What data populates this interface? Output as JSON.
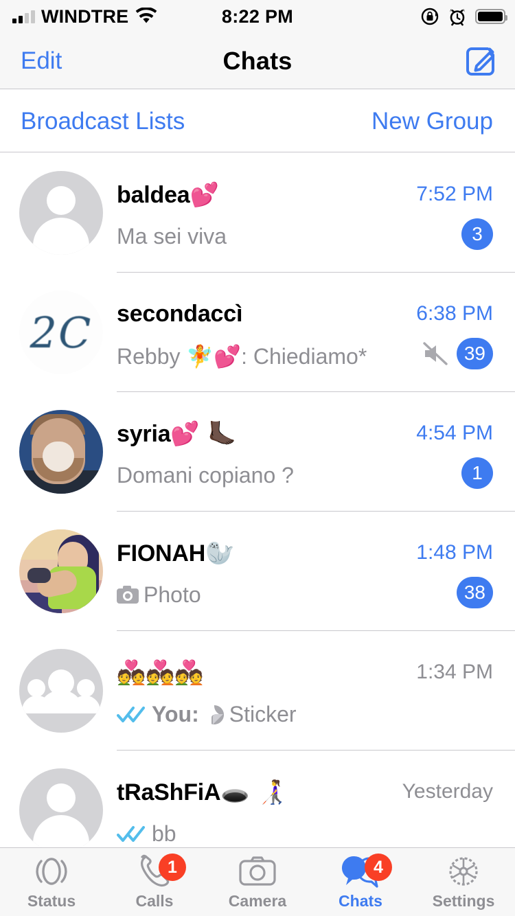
{
  "status_bar": {
    "carrier": "WINDTRE",
    "time": "8:22 PM",
    "wifi_icon": "wifi-icon",
    "rotation_lock_icon": "rotation-lock-icon",
    "alarm_icon": "alarm-icon",
    "battery_icon": "battery-full-icon"
  },
  "nav_bar": {
    "edit_label": "Edit",
    "title": "Chats",
    "compose_icon": "compose-icon"
  },
  "sub_header": {
    "broadcast_label": "Broadcast Lists",
    "new_group_label": "New Group"
  },
  "colors": {
    "accent_blue": "#3e7bf0",
    "badge_red": "#f93f25",
    "secondary_text": "#8e8e93",
    "separator": "#c8c7cc",
    "bar_background": "#f7f7f7"
  },
  "chats": [
    {
      "name": "baldea",
      "name_emoji": "💕",
      "preview": "Ma sei viva",
      "time": "7:52 PM",
      "unread": "3",
      "muted": false,
      "avatar": "default-person-avatar"
    },
    {
      "name": "secondaccì",
      "name_emoji": "",
      "preview_sender": "Rebby 🧚💕",
      "preview": "Rebby 🧚💕: Chiediamo*",
      "time": "6:38 PM",
      "unread": "39",
      "muted": true,
      "avatar": "handwritten-2c-avatar",
      "avatar_text": "2C"
    },
    {
      "name": "syria",
      "name_emoji": "💕 🦶🏿",
      "preview": "Domani copiano ?",
      "time": "4:54 PM",
      "unread": "1",
      "muted": false,
      "avatar": "photo-avatar-laughing-man"
    },
    {
      "name": "FIONAH",
      "name_emoji": "🦭",
      "preview": "Photo",
      "preview_icon": "camera-icon",
      "time": "1:48 PM",
      "unread": "38",
      "muted": false,
      "avatar": "photo-avatar-illustration-girl"
    },
    {
      "name": "💑💑💑",
      "name_emoji": "",
      "preview_prefix": "You:",
      "preview": "Sticker",
      "preview_icon": "sticker-icon",
      "read_receipt": "double-check-blue",
      "time": "1:34 PM",
      "unread": "",
      "muted": false,
      "avatar": "default-group-avatar"
    },
    {
      "name": "tRaShFiA",
      "name_emoji": "🕳️ 👩‍🦯",
      "preview": "bb",
      "read_receipt": "double-check-blue",
      "time": "Yesterday",
      "unread": "",
      "muted": false,
      "avatar": "default-person-avatar"
    }
  ],
  "tab_bar": {
    "tabs": [
      {
        "label": "Status",
        "icon": "status-rings-icon",
        "badge": "",
        "active": false
      },
      {
        "label": "Calls",
        "icon": "phone-icon",
        "badge": "1",
        "active": false
      },
      {
        "label": "Camera",
        "icon": "camera-icon",
        "badge": "",
        "active": false
      },
      {
        "label": "Chats",
        "icon": "chat-bubbles-icon",
        "badge": "4",
        "active": true
      },
      {
        "label": "Settings",
        "icon": "gear-icon",
        "badge": "",
        "active": false
      }
    ]
  }
}
